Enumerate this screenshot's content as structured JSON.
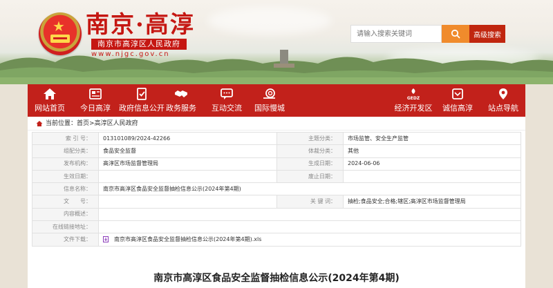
{
  "header": {
    "site_title": "南京·高淳",
    "subtitle": "南京市高淳区人民政府",
    "url": "www.njgc.gov.cn",
    "search_placeholder": "请输入搜索关键词",
    "advanced_search": "高级搜索",
    "search_icon": "magnifier-icon",
    "emblem_icon": "national-emblem-icon",
    "accent_color": "#c2211b"
  },
  "nav": {
    "items": [
      {
        "label": "网站首页",
        "icon": "home-icon"
      },
      {
        "label": "今日高淳",
        "icon": "newspaper-icon"
      },
      {
        "label": "政府信息公开",
        "icon": "checklist-icon"
      },
      {
        "label": "政务服务",
        "icon": "handshake-icon"
      },
      {
        "label": "互动交流",
        "icon": "chat-icon"
      },
      {
        "label": "国际慢城",
        "icon": "snail-icon"
      },
      {
        "label": "经济开发区",
        "icon": "gedz-icon"
      },
      {
        "label": "诚信高淳",
        "icon": "credit-icon"
      },
      {
        "label": "站点导航",
        "icon": "location-icon"
      }
    ]
  },
  "breadcrumb": {
    "prefix": "当前位置：",
    "items": [
      "首页",
      "高淳区人民政府"
    ],
    "separator": " > "
  },
  "meta": {
    "rows": [
      {
        "k1": "索 引 号：",
        "v1": "013101089/2024-42266",
        "k2": "主题分类：",
        "v2": "市场监管、安全生产监管"
      },
      {
        "k1": "组配分类：",
        "v1": "食品安全监督",
        "k2": "体裁分类：",
        "v2": "其他"
      },
      {
        "k1": "发布机构：",
        "v1": "高淳区市场监督管理局",
        "k2": "生成日期：",
        "v2": "2024-06-06"
      },
      {
        "k1": "生效日期：",
        "v1": "",
        "k2": "废止日期：",
        "v2": ""
      },
      {
        "k1": "信息名称：",
        "v1": "南京市高淳区食品安全监督抽检信息公示(2024年第4期)",
        "k2": "",
        "v2": ""
      },
      {
        "k1": "文　　号：",
        "v1": "",
        "k2": "关 键 词：",
        "v2": "抽检;食品安全;合格;辖区;高淳区市场监督管理局"
      },
      {
        "k1": "内容概述：",
        "v1": "",
        "k2": "",
        "v2": ""
      },
      {
        "k1": "在线链接地址：",
        "v1": "",
        "k2": "",
        "v2": ""
      },
      {
        "k1": "文件下载：",
        "v1": "南京市高淳区食品安全监督抽检信息公示(2024年第4期).xls",
        "k2": "",
        "v2": ""
      }
    ]
  },
  "article": {
    "title": "南京市高淳区食品安全监督抽检信息公示(2024年第4期)"
  }
}
